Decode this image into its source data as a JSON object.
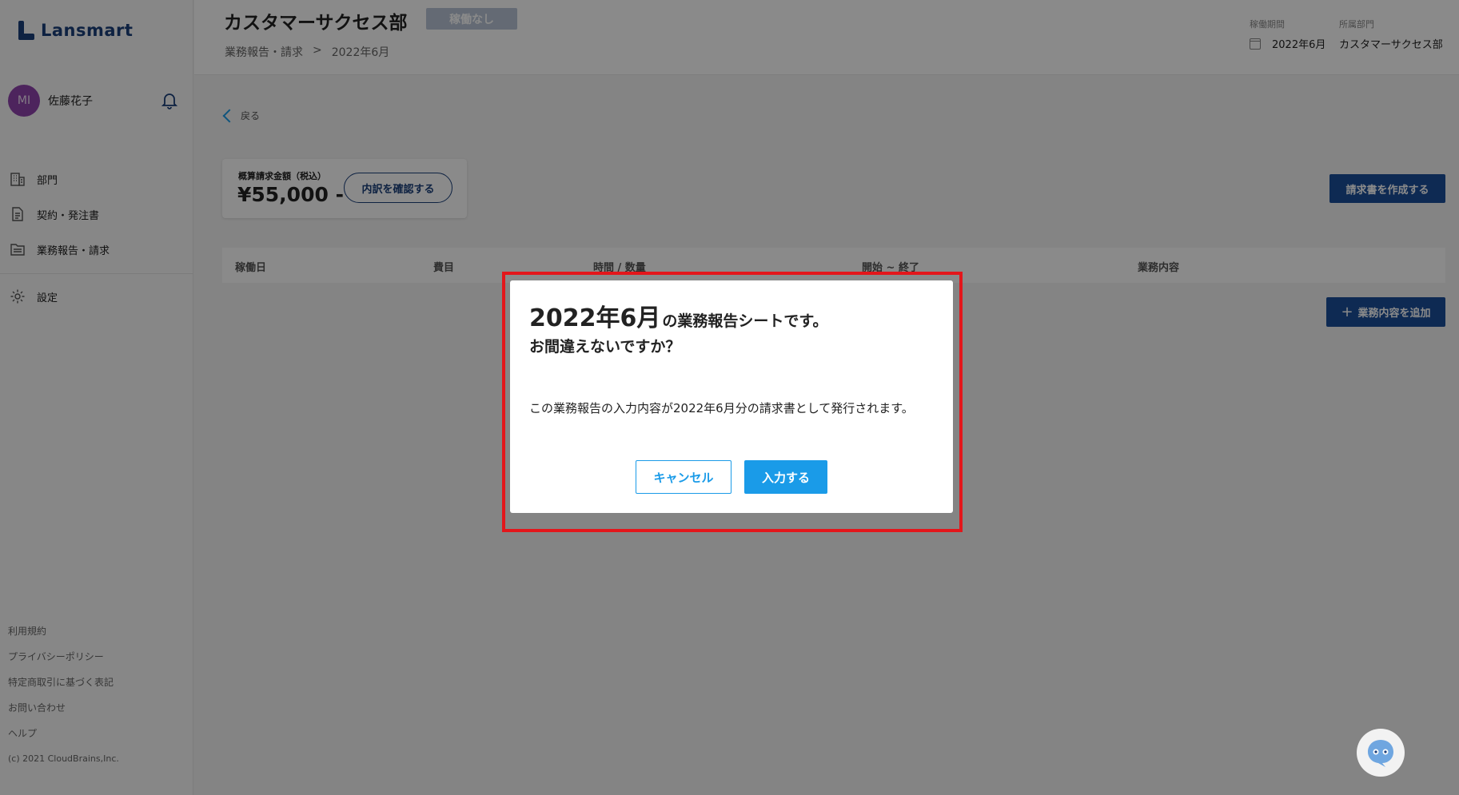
{
  "app": {
    "logo_text": "Lansmart"
  },
  "user": {
    "initials": "MI",
    "name": "佐藤花子"
  },
  "nav": {
    "items": [
      {
        "label": "部門",
        "icon": "building-icon"
      },
      {
        "label": "契約・発注書",
        "icon": "document-icon"
      },
      {
        "label": "業務報告・請求",
        "icon": "folder-icon"
      }
    ],
    "settings_label": "設定"
  },
  "footer": {
    "terms": "利用規約",
    "privacy": "プライバシーポリシー",
    "commerce": "特定商取引に基づく表記",
    "contact": "お問い合わせ",
    "help": "ヘルプ",
    "copyright": "(c) 2021 CloudBrains,Inc."
  },
  "header": {
    "title": "カスタマーサクセス部",
    "status_badge": "稼働なし",
    "breadcrumb": [
      "業務報告・請求",
      ">",
      "2022年6月"
    ],
    "period_label": "稼働期間",
    "period_value": "2022年6月",
    "dept_label": "所属部門",
    "dept_value": "カスタマーサクセス部"
  },
  "main": {
    "back_label": "戻る",
    "summary_label": "概算請求金額（税込）",
    "summary_amount": "¥55,000 -",
    "detail_button": "内訳を確認する",
    "invoice_button": "請求書を作成する",
    "table_headers": [
      "稼働日",
      "費目",
      "時間 / 数量",
      "開始 ~ 終了",
      "業務内容"
    ],
    "add_button": "業務内容を追加"
  },
  "modal": {
    "month": "2022年6月",
    "title_rest": "の業務報告シートです。",
    "subtitle": "お間違えないですか？",
    "body": "この業務報告の入力内容が2022年6月分の請求書として発行されます。",
    "cancel_label": "キャンセル",
    "confirm_label": "入力する"
  },
  "colors": {
    "brand": "#1b3f7a",
    "accent": "#1a9be8",
    "primary_button": "#1b4f9a",
    "highlight": "#e3161b"
  }
}
